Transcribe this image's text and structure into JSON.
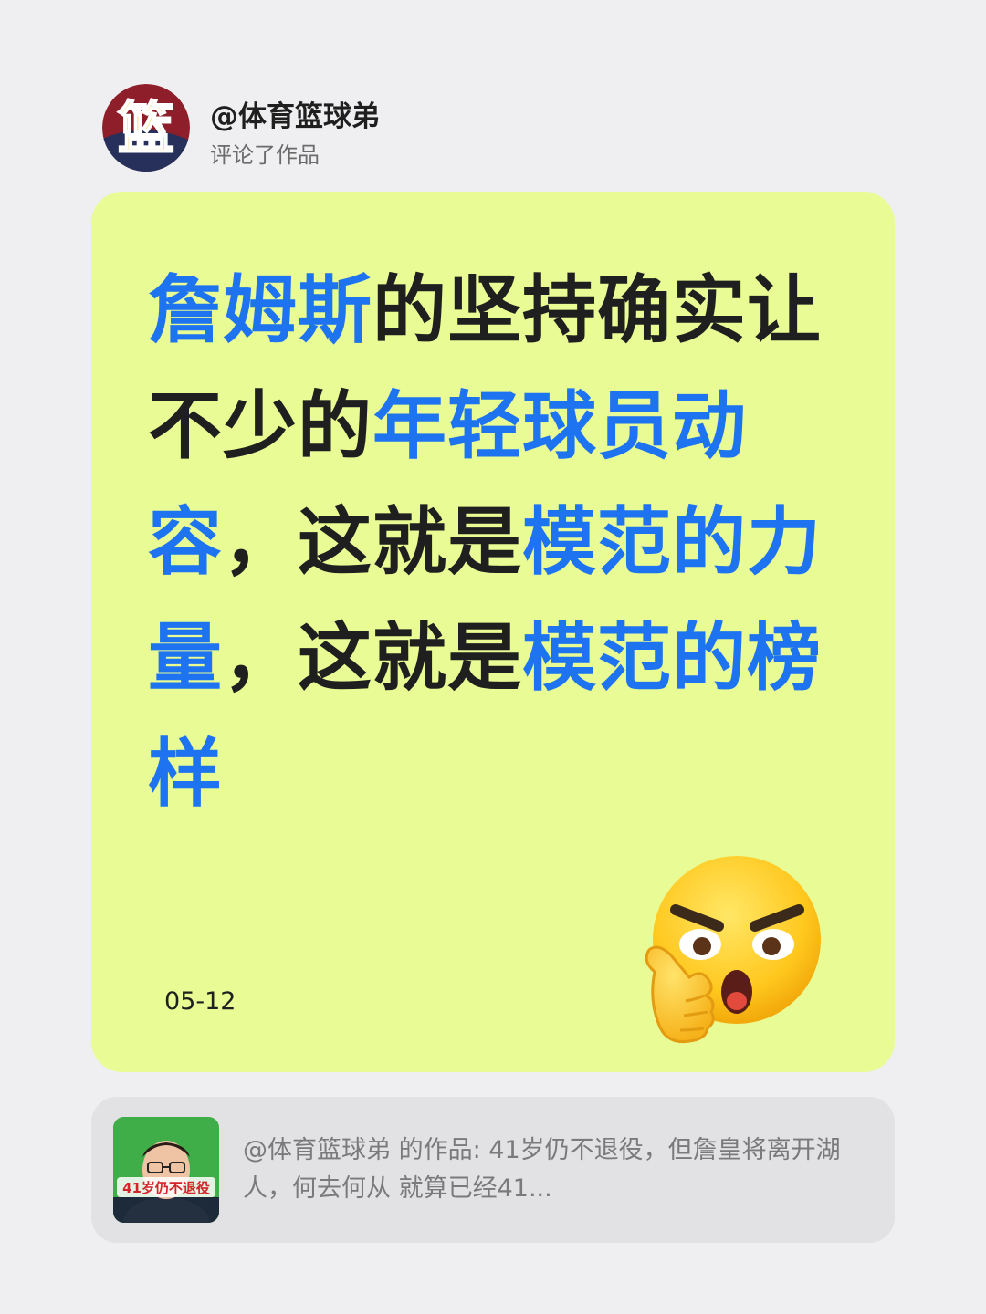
{
  "post": {
    "user_name": "@体育篮球弟",
    "action": "评论了作品",
    "avatar_text": "篮"
  },
  "comment": {
    "segments": [
      {
        "text": "詹姆斯",
        "highlight": true
      },
      {
        "text": "的坚持确实让不少的",
        "highlight": false
      },
      {
        "text": "年轻球员动容",
        "highlight": true
      },
      {
        "text": "，这就是",
        "highlight": false
      },
      {
        "text": "模范的力量",
        "highlight": true
      },
      {
        "text": "，这就是",
        "highlight": false
      },
      {
        "text": "模范的榜样",
        "highlight": true
      }
    ],
    "date": "05-12",
    "emoji": "thinking-angry-face-emoji"
  },
  "reference": {
    "thumb_caption": "41岁仍不退役",
    "text": "@体育篮球弟 的作品: 41岁仍不退役，但詹皇将离开湖人，何去何从 就算已经41..."
  },
  "colors": {
    "background": "#efeff1",
    "card": "#e8fb94",
    "highlight": "#1e74f0",
    "text": "#1f1f1f",
    "muted": "#7a7a7c"
  }
}
